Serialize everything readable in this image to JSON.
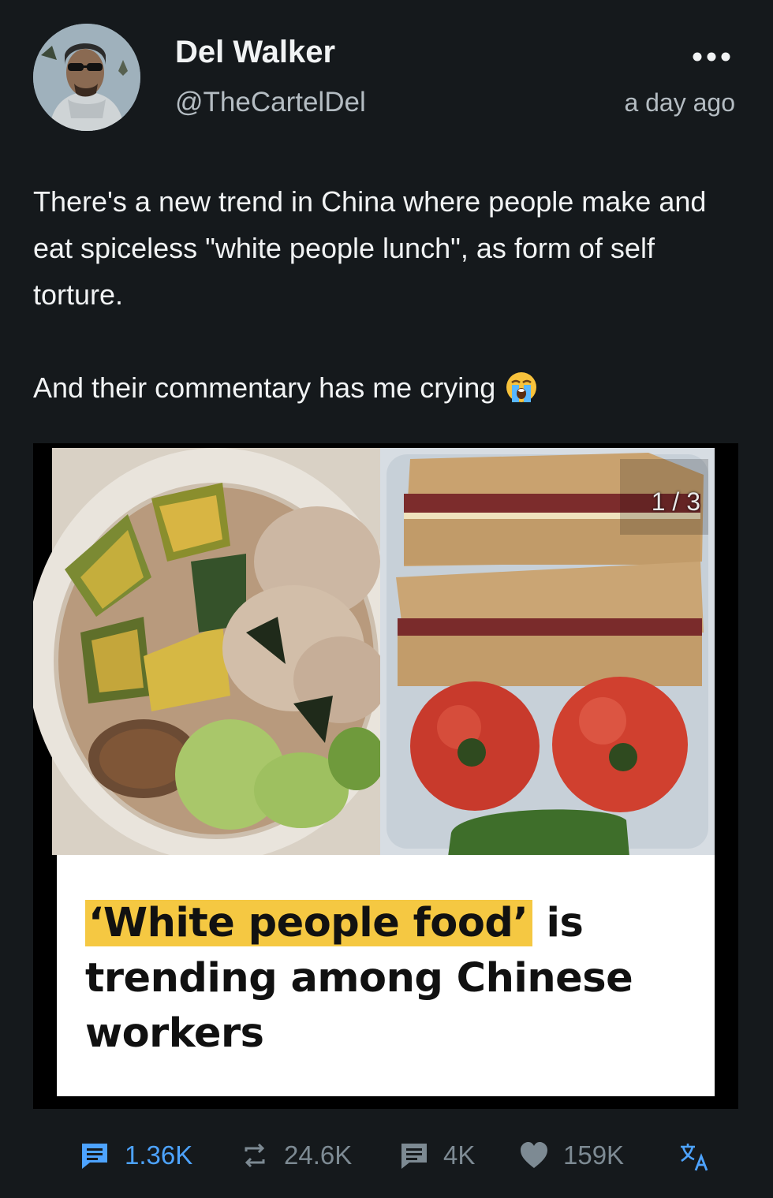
{
  "post": {
    "author_name": "Del Walker",
    "author_handle": "@TheCartelDel",
    "timestamp": "a day ago",
    "text_paragraphs": [
      "There's a new trend in China where people make and eat spiceless \"white people lunch\", as form of self torture.",
      "And their commentary has me crying"
    ],
    "emoji": "loudly-crying-face"
  },
  "media": {
    "counter": "1 / 3",
    "headline_highlight": "‘White people food’",
    "headline_rest": " is trending among Chinese workers"
  },
  "actions": {
    "replies": "1.36K",
    "reposts": "24.6K",
    "quotes": "4K",
    "likes": "159K"
  },
  "colors": {
    "background": "#15191c",
    "accent": "#4da3ff",
    "muted": "#7d8a93",
    "highlight": "#f5c842"
  }
}
